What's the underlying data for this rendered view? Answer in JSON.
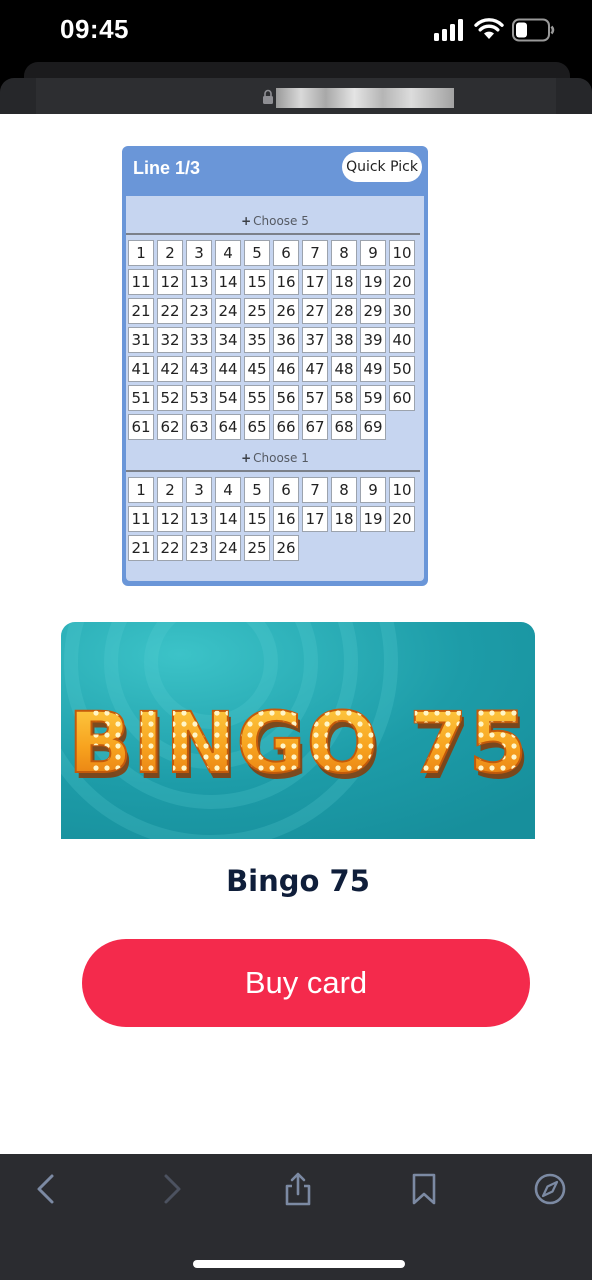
{
  "status_bar": {
    "time": "09:45",
    "icons": [
      "signal-icon",
      "wifi-icon",
      "battery-icon"
    ]
  },
  "browser": {
    "url_field": "",
    "lock_icon": "lock-icon"
  },
  "line_panel": {
    "title": "Line 1/3",
    "quick_pick_label": "Quick Pick",
    "sections": [
      {
        "label": "Choose 5",
        "numbers": [
          "1",
          "2",
          "3",
          "4",
          "5",
          "6",
          "7",
          "8",
          "9",
          "10",
          "11",
          "12",
          "13",
          "14",
          "15",
          "16",
          "17",
          "18",
          "19",
          "20",
          "21",
          "22",
          "23",
          "24",
          "25",
          "26",
          "27",
          "28",
          "29",
          "30",
          "31",
          "32",
          "33",
          "34",
          "35",
          "36",
          "37",
          "38",
          "39",
          "40",
          "41",
          "42",
          "43",
          "44",
          "45",
          "46",
          "47",
          "48",
          "49",
          "50",
          "51",
          "52",
          "53",
          "54",
          "55",
          "56",
          "57",
          "58",
          "59",
          "60",
          "61",
          "62",
          "63",
          "64",
          "65",
          "66",
          "67",
          "68",
          "69"
        ]
      },
      {
        "label": "Choose 1",
        "numbers": [
          "1",
          "2",
          "3",
          "4",
          "5",
          "6",
          "7",
          "8",
          "9",
          "10",
          "11",
          "12",
          "13",
          "14",
          "15",
          "16",
          "17",
          "18",
          "19",
          "20",
          "21",
          "22",
          "23",
          "24",
          "25",
          "26"
        ]
      }
    ]
  },
  "game": {
    "banner_text": "BINGO 75",
    "name": "Bingo 75"
  },
  "buy_button_label": "Buy card",
  "bottom_toolbar": {
    "icons": [
      "back-icon",
      "forward-icon",
      "share-icon",
      "bookmarks-icon",
      "compass-icon"
    ]
  },
  "colors": {
    "panel_header": "#6a96d8",
    "panel_body": "#c6d5f0",
    "buy_button": "#f42a4c",
    "banner_teal": "#1f9ea9",
    "title_navy": "#0f1e3a",
    "marquee_orange": "#f39a1e"
  }
}
